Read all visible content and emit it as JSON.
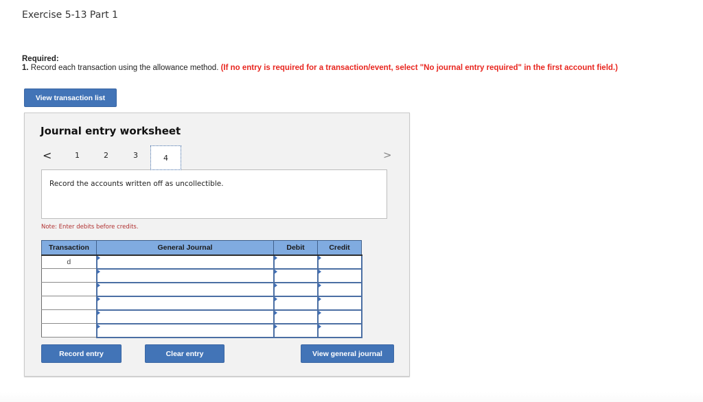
{
  "page": {
    "title": "Exercise 5-13 Part 1",
    "required_label": "Required:",
    "instruction_number": "1.",
    "instruction_text": " Record each transaction using the allowance method. ",
    "instruction_warning": "(If no entry is required for a transaction/event, select \"No journal entry required\" in the first account field.)"
  },
  "buttons": {
    "view_transaction_list": "View transaction list",
    "record_entry": "Record entry",
    "clear_entry": "Clear entry",
    "view_general_journal": "View general journal"
  },
  "worksheet": {
    "title": "Journal entry worksheet",
    "prev_icon": "<",
    "next_icon": ">",
    "pages": [
      "1",
      "2",
      "3",
      "4"
    ],
    "active_page": "4",
    "description": "Record the accounts written off as uncollectible.",
    "note": "Note: Enter debits before credits."
  },
  "journal": {
    "headers": {
      "transaction": "Transaction",
      "general_journal": "General Journal",
      "debit": "Debit",
      "credit": "Credit"
    },
    "rows": [
      {
        "transaction": "d",
        "account": "",
        "debit": "",
        "credit": ""
      },
      {
        "transaction": "",
        "account": "",
        "debit": "",
        "credit": ""
      },
      {
        "transaction": "",
        "account": "",
        "debit": "",
        "credit": ""
      },
      {
        "transaction": "",
        "account": "",
        "debit": "",
        "credit": ""
      },
      {
        "transaction": "",
        "account": "",
        "debit": "",
        "credit": ""
      },
      {
        "transaction": "",
        "account": "",
        "debit": "",
        "credit": ""
      }
    ]
  },
  "colors": {
    "button_blue": "#4274b7",
    "header_blue": "#80abe0",
    "warning_red": "#e8261f",
    "note_red": "#b03030"
  }
}
